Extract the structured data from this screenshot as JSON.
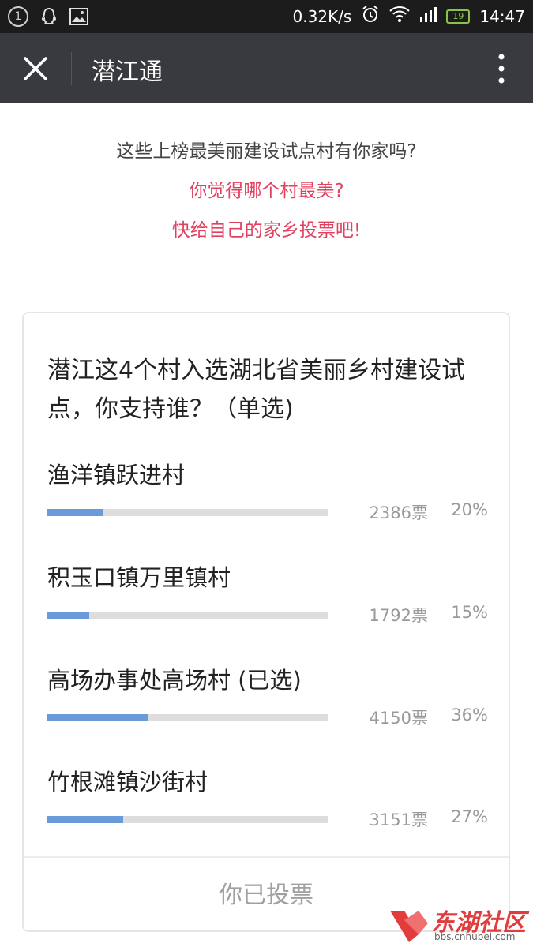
{
  "status_bar": {
    "notification_count": "1",
    "net_speed": "0.32K/s",
    "battery": "19",
    "time": "14:47"
  },
  "header": {
    "title": "潜江通"
  },
  "intro": {
    "line1": "这些上榜最美丽建设试点村有你家吗?",
    "line2": "你觉得哪个村最美?",
    "line3": "快给自己的家乡投票吧!"
  },
  "poll": {
    "question": "潜江这4个村入选湖北省美丽乡村建设试点，你支持谁？（单选)",
    "options": [
      {
        "label": "渔洋镇跃进村",
        "votes": "2386票",
        "percent": "20%",
        "fill": 0.2
      },
      {
        "label": "积玉口镇万里镇村",
        "votes": "1792票",
        "percent": "15%",
        "fill": 0.15
      },
      {
        "label": "高场办事处高场村 (已选)",
        "votes": "4150票",
        "percent": "36%",
        "fill": 0.36
      },
      {
        "label": "竹根滩镇沙街村",
        "votes": "3151票",
        "percent": "27%",
        "fill": 0.27
      }
    ],
    "voted_label": "你已投票"
  },
  "watermark": {
    "brand": "东湖社区",
    "url": "bbs.cnhubei.com"
  },
  "colors": {
    "accent_red": "#e0415e",
    "bar_fill": "#6a9ad8",
    "titlebar": "#393a3f"
  }
}
